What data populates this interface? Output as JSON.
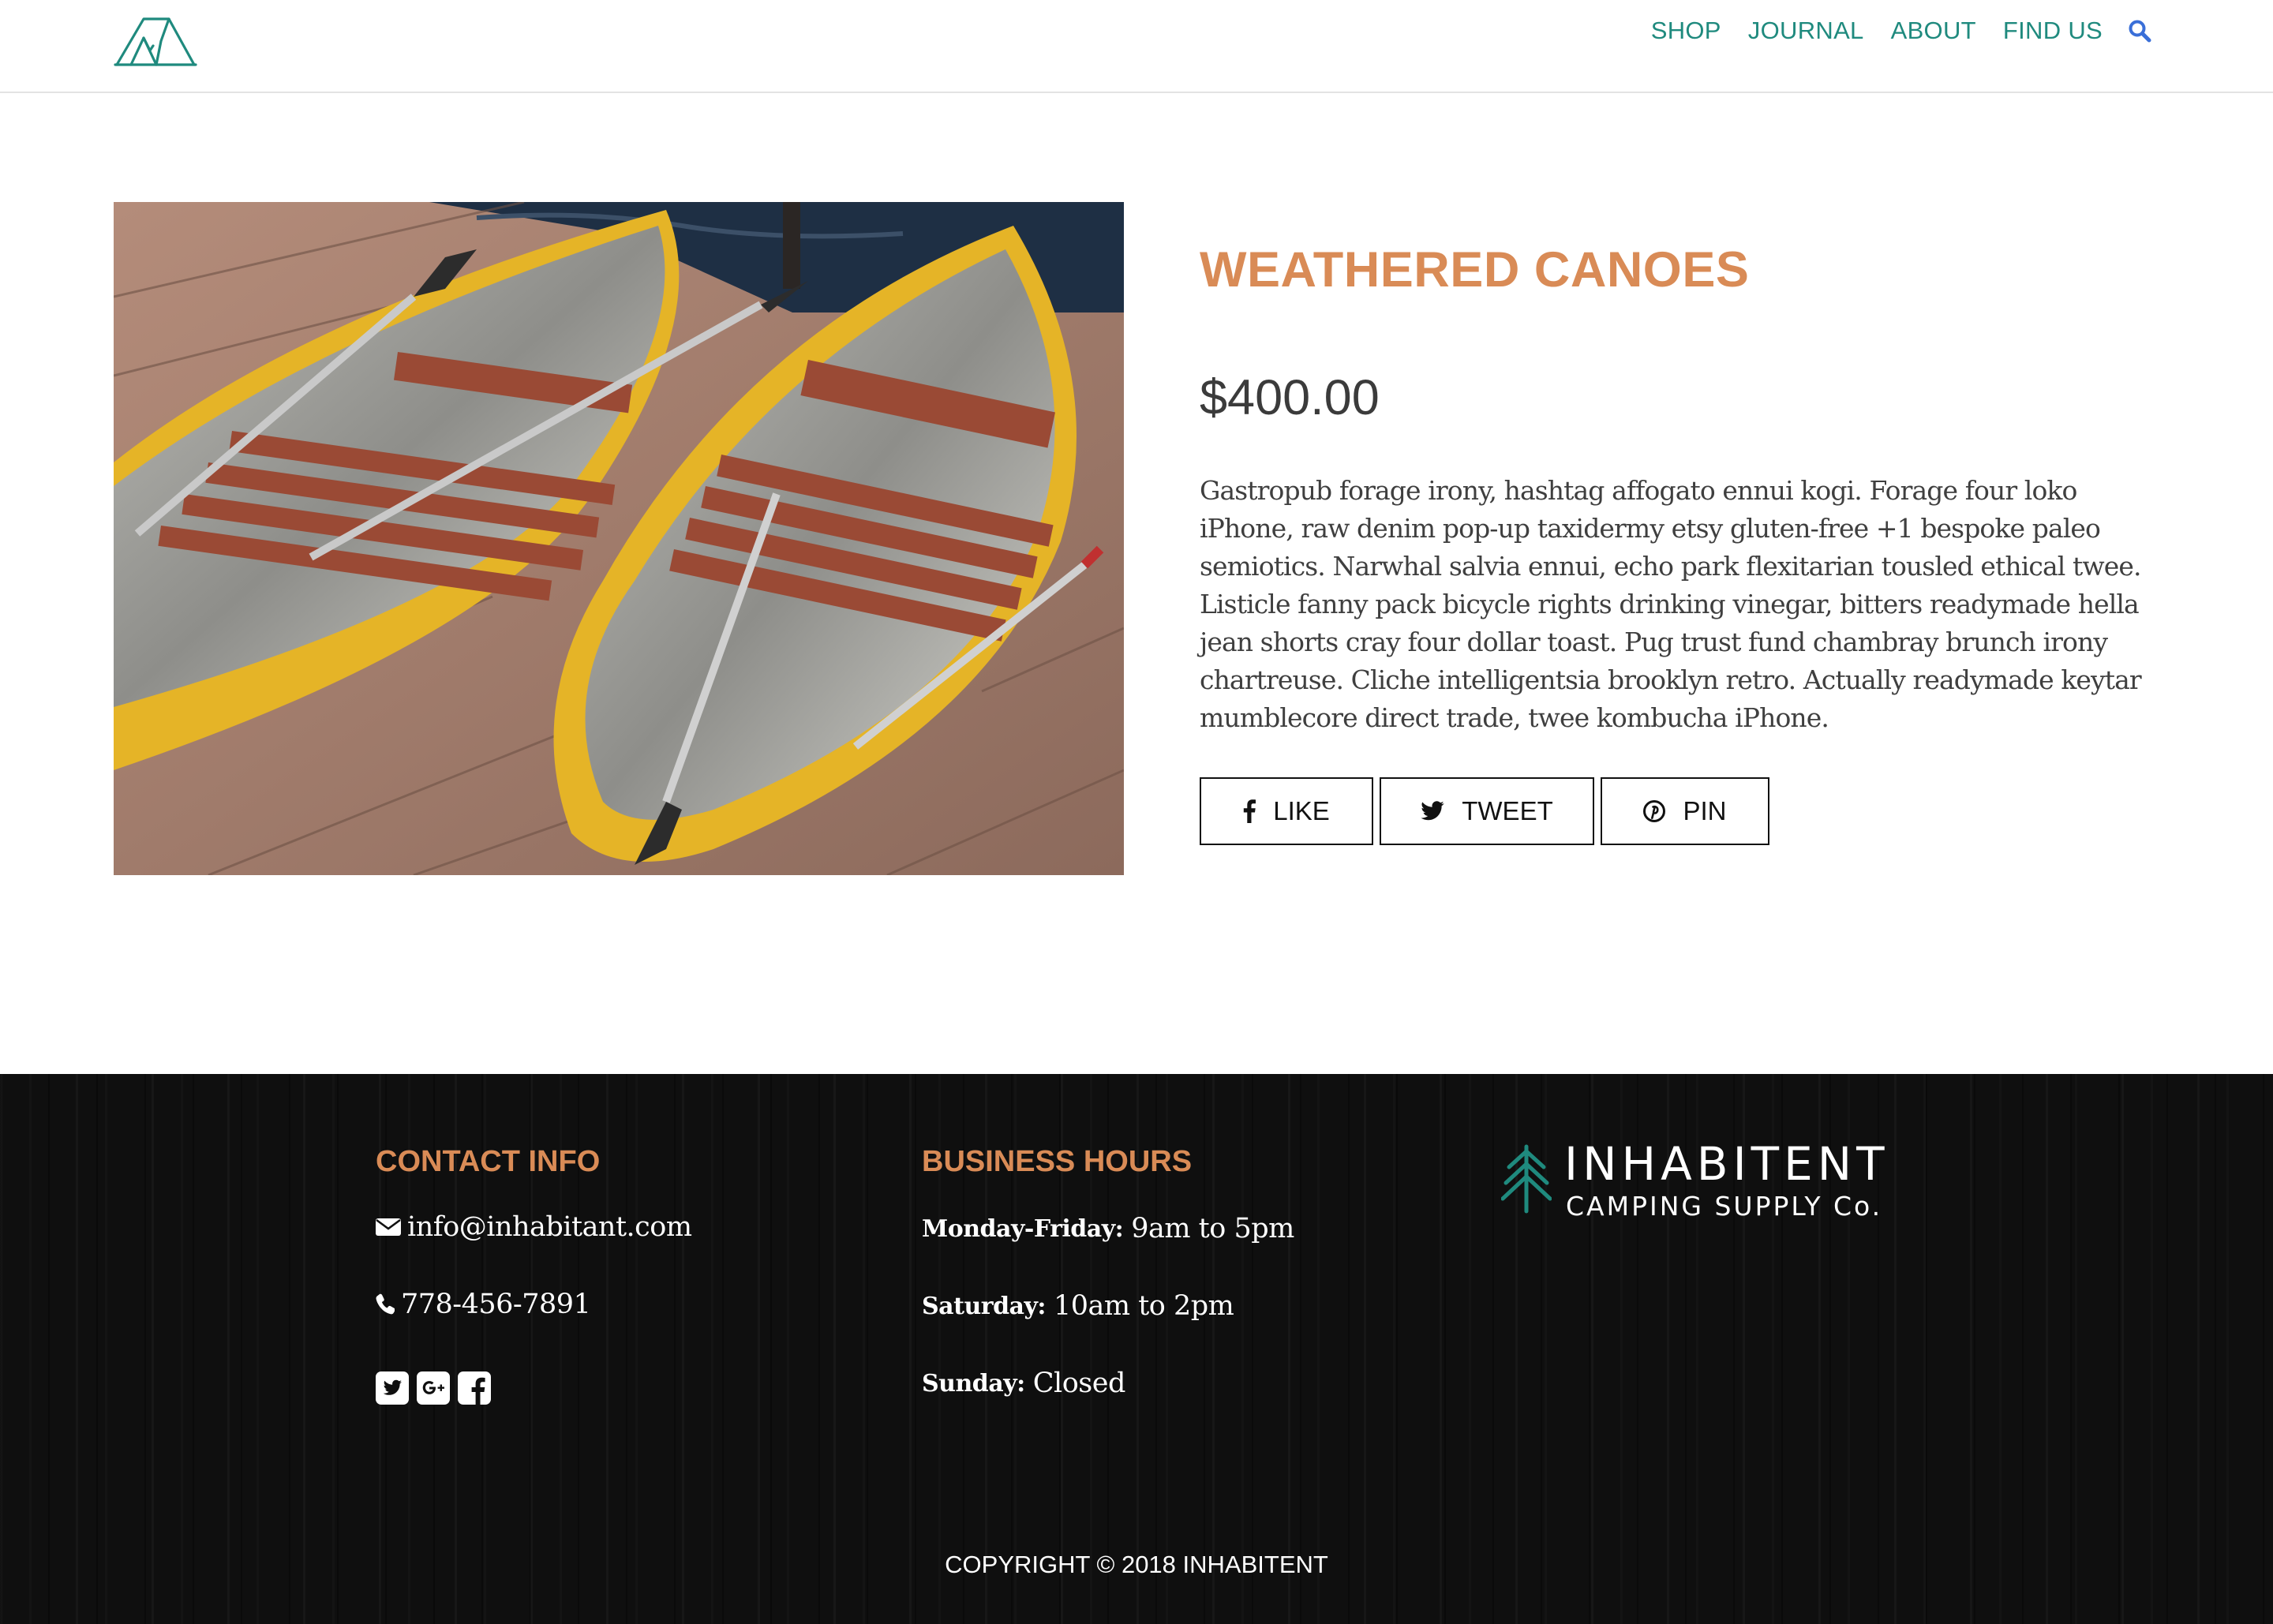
{
  "header": {
    "logo_icon": "tent-logo-icon",
    "nav": [
      "SHOP",
      "JOURNAL",
      "ABOUT",
      "FIND US"
    ],
    "search_icon": "search-icon"
  },
  "product": {
    "image_icon": "two-canoes-photo",
    "title": "WEATHERED CANOES",
    "price": "$400.00",
    "description": "Gastropub forage irony, hashtag affogato ennui kogi. Forage four loko iPhone, raw denim pop-up taxidermy etsy gluten-free +1 bespoke paleo semiotics. Narwhal salvia ennui, echo park flexitarian tousled ethical twee. Listicle fanny pack bicycle rights drinking vinegar, bitters readymade hella jean shorts cray four dollar toast. Pug trust fund chambray brunch irony chartreuse. Cliche intelligentsia brooklyn retro. Actually readymade keytar mumblecore direct trade, twee kombucha iPhone.",
    "share": {
      "like": "LIKE",
      "tweet": "TWEET",
      "pin": "PIN"
    }
  },
  "footer": {
    "contact": {
      "heading": "CONTACT INFO",
      "email": "info@inhabitant.com",
      "phone": "778-456-7891"
    },
    "hours": {
      "heading": "BUSINESS HOURS",
      "rows": [
        {
          "day": "Monday-Friday:",
          "time": "9am to 5pm"
        },
        {
          "day": "Saturday:",
          "time": "10am to 2pm"
        },
        {
          "day": "Sunday:",
          "time": "Closed"
        }
      ]
    },
    "brand": {
      "name": "INHABITENT",
      "tagline": "CAMPING SUPPLY Co."
    },
    "copyright": "COPYRIGHT © 2018 INHABITENT"
  },
  "colors": {
    "teal": "#1f8a7e",
    "accent_orange": "#d98b56",
    "search_blue": "#3a6fd8",
    "footer_bg": "#0f0f0f"
  }
}
